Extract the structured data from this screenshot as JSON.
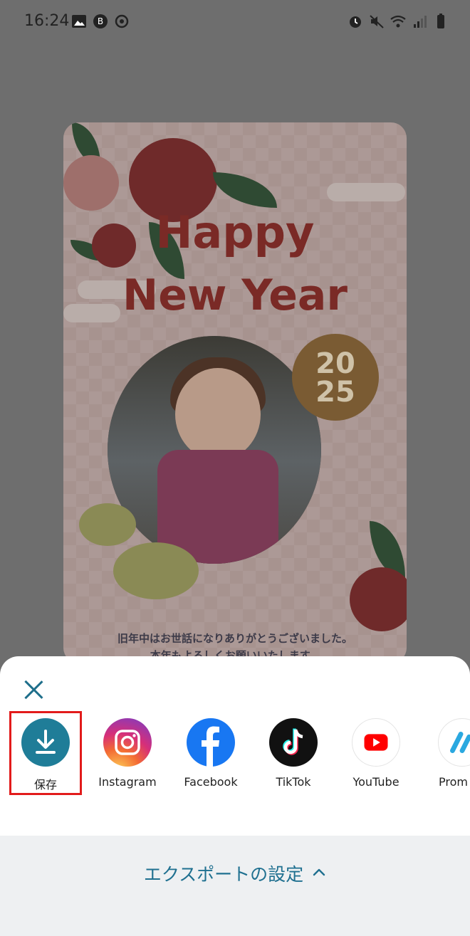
{
  "status_bar": {
    "time": "16:24",
    "left_icons": [
      "gallery-icon",
      "bitcoin-icon",
      "sync-icon"
    ],
    "right_icons": [
      "alarm-icon",
      "mute-icon",
      "wifi-icon",
      "signal-icon",
      "battery-icon"
    ]
  },
  "card": {
    "title_line1": "Happy",
    "title_line2": "New Year",
    "year_line1": "20",
    "year_line2": "25",
    "message_line1": "旧年中はお世話になりありがとうございました。",
    "message_line2": "本年もよろしくお願いいたします。"
  },
  "share_sheet": {
    "close_icon": "close-icon",
    "items": [
      {
        "label": "保存",
        "icon": "download-icon",
        "color": "#1f7d98"
      },
      {
        "label": "Instagram",
        "icon": "instagram-icon"
      },
      {
        "label": "Facebook",
        "icon": "facebook-icon",
        "color": "#1877f2"
      },
      {
        "label": "TikTok",
        "icon": "tiktok-icon",
        "color": "#111111"
      },
      {
        "label": "YouTube",
        "icon": "youtube-icon",
        "color": "#ff0000"
      },
      {
        "label": "Prom",
        "icon": "promeo-icon"
      }
    ],
    "export_settings_label": "エクスポートの設定",
    "export_settings_icon": "chevron-up-icon"
  },
  "colors": {
    "accent": "#1f7d98",
    "highlight": "#e21b1b"
  }
}
